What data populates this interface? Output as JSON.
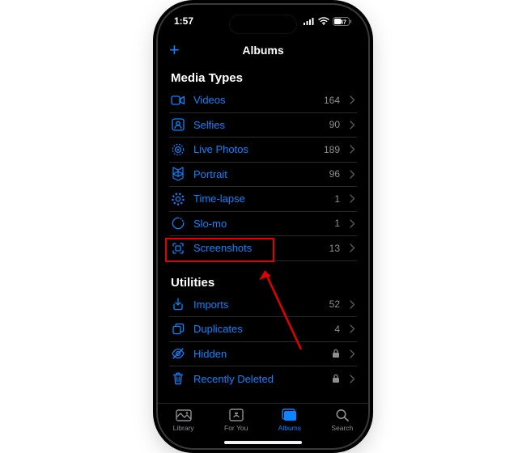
{
  "status": {
    "time": "1:57",
    "battery": "47"
  },
  "nav": {
    "title": "Albums",
    "add_glyph": "+"
  },
  "sections": {
    "media_types": {
      "header": "Media Types",
      "items": [
        {
          "icon": "video-icon",
          "label": "Videos",
          "count": "164"
        },
        {
          "icon": "selfies-icon",
          "label": "Selfies",
          "count": "90"
        },
        {
          "icon": "livephotos-icon",
          "label": "Live Photos",
          "count": "189"
        },
        {
          "icon": "portrait-icon",
          "label": "Portrait",
          "count": "96"
        },
        {
          "icon": "timelapse-icon",
          "label": "Time-lapse",
          "count": "1"
        },
        {
          "icon": "slomo-icon",
          "label": "Slo-mo",
          "count": "1"
        },
        {
          "icon": "screenshots-icon",
          "label": "Screenshots",
          "count": "13"
        }
      ]
    },
    "utilities": {
      "header": "Utilities",
      "items": [
        {
          "icon": "imports-icon",
          "label": "Imports",
          "count": "52"
        },
        {
          "icon": "duplicates-icon",
          "label": "Duplicates",
          "count": "4"
        },
        {
          "icon": "hidden-icon",
          "label": "Hidden",
          "locked": true
        },
        {
          "icon": "trash-icon",
          "label": "Recently Deleted",
          "locked": true
        }
      ]
    }
  },
  "tabs": {
    "library": "Library",
    "foryou": "For You",
    "albums": "Albums",
    "search": "Search"
  },
  "colors": {
    "accent": "#0a84ff",
    "annotation": "#e20000"
  }
}
